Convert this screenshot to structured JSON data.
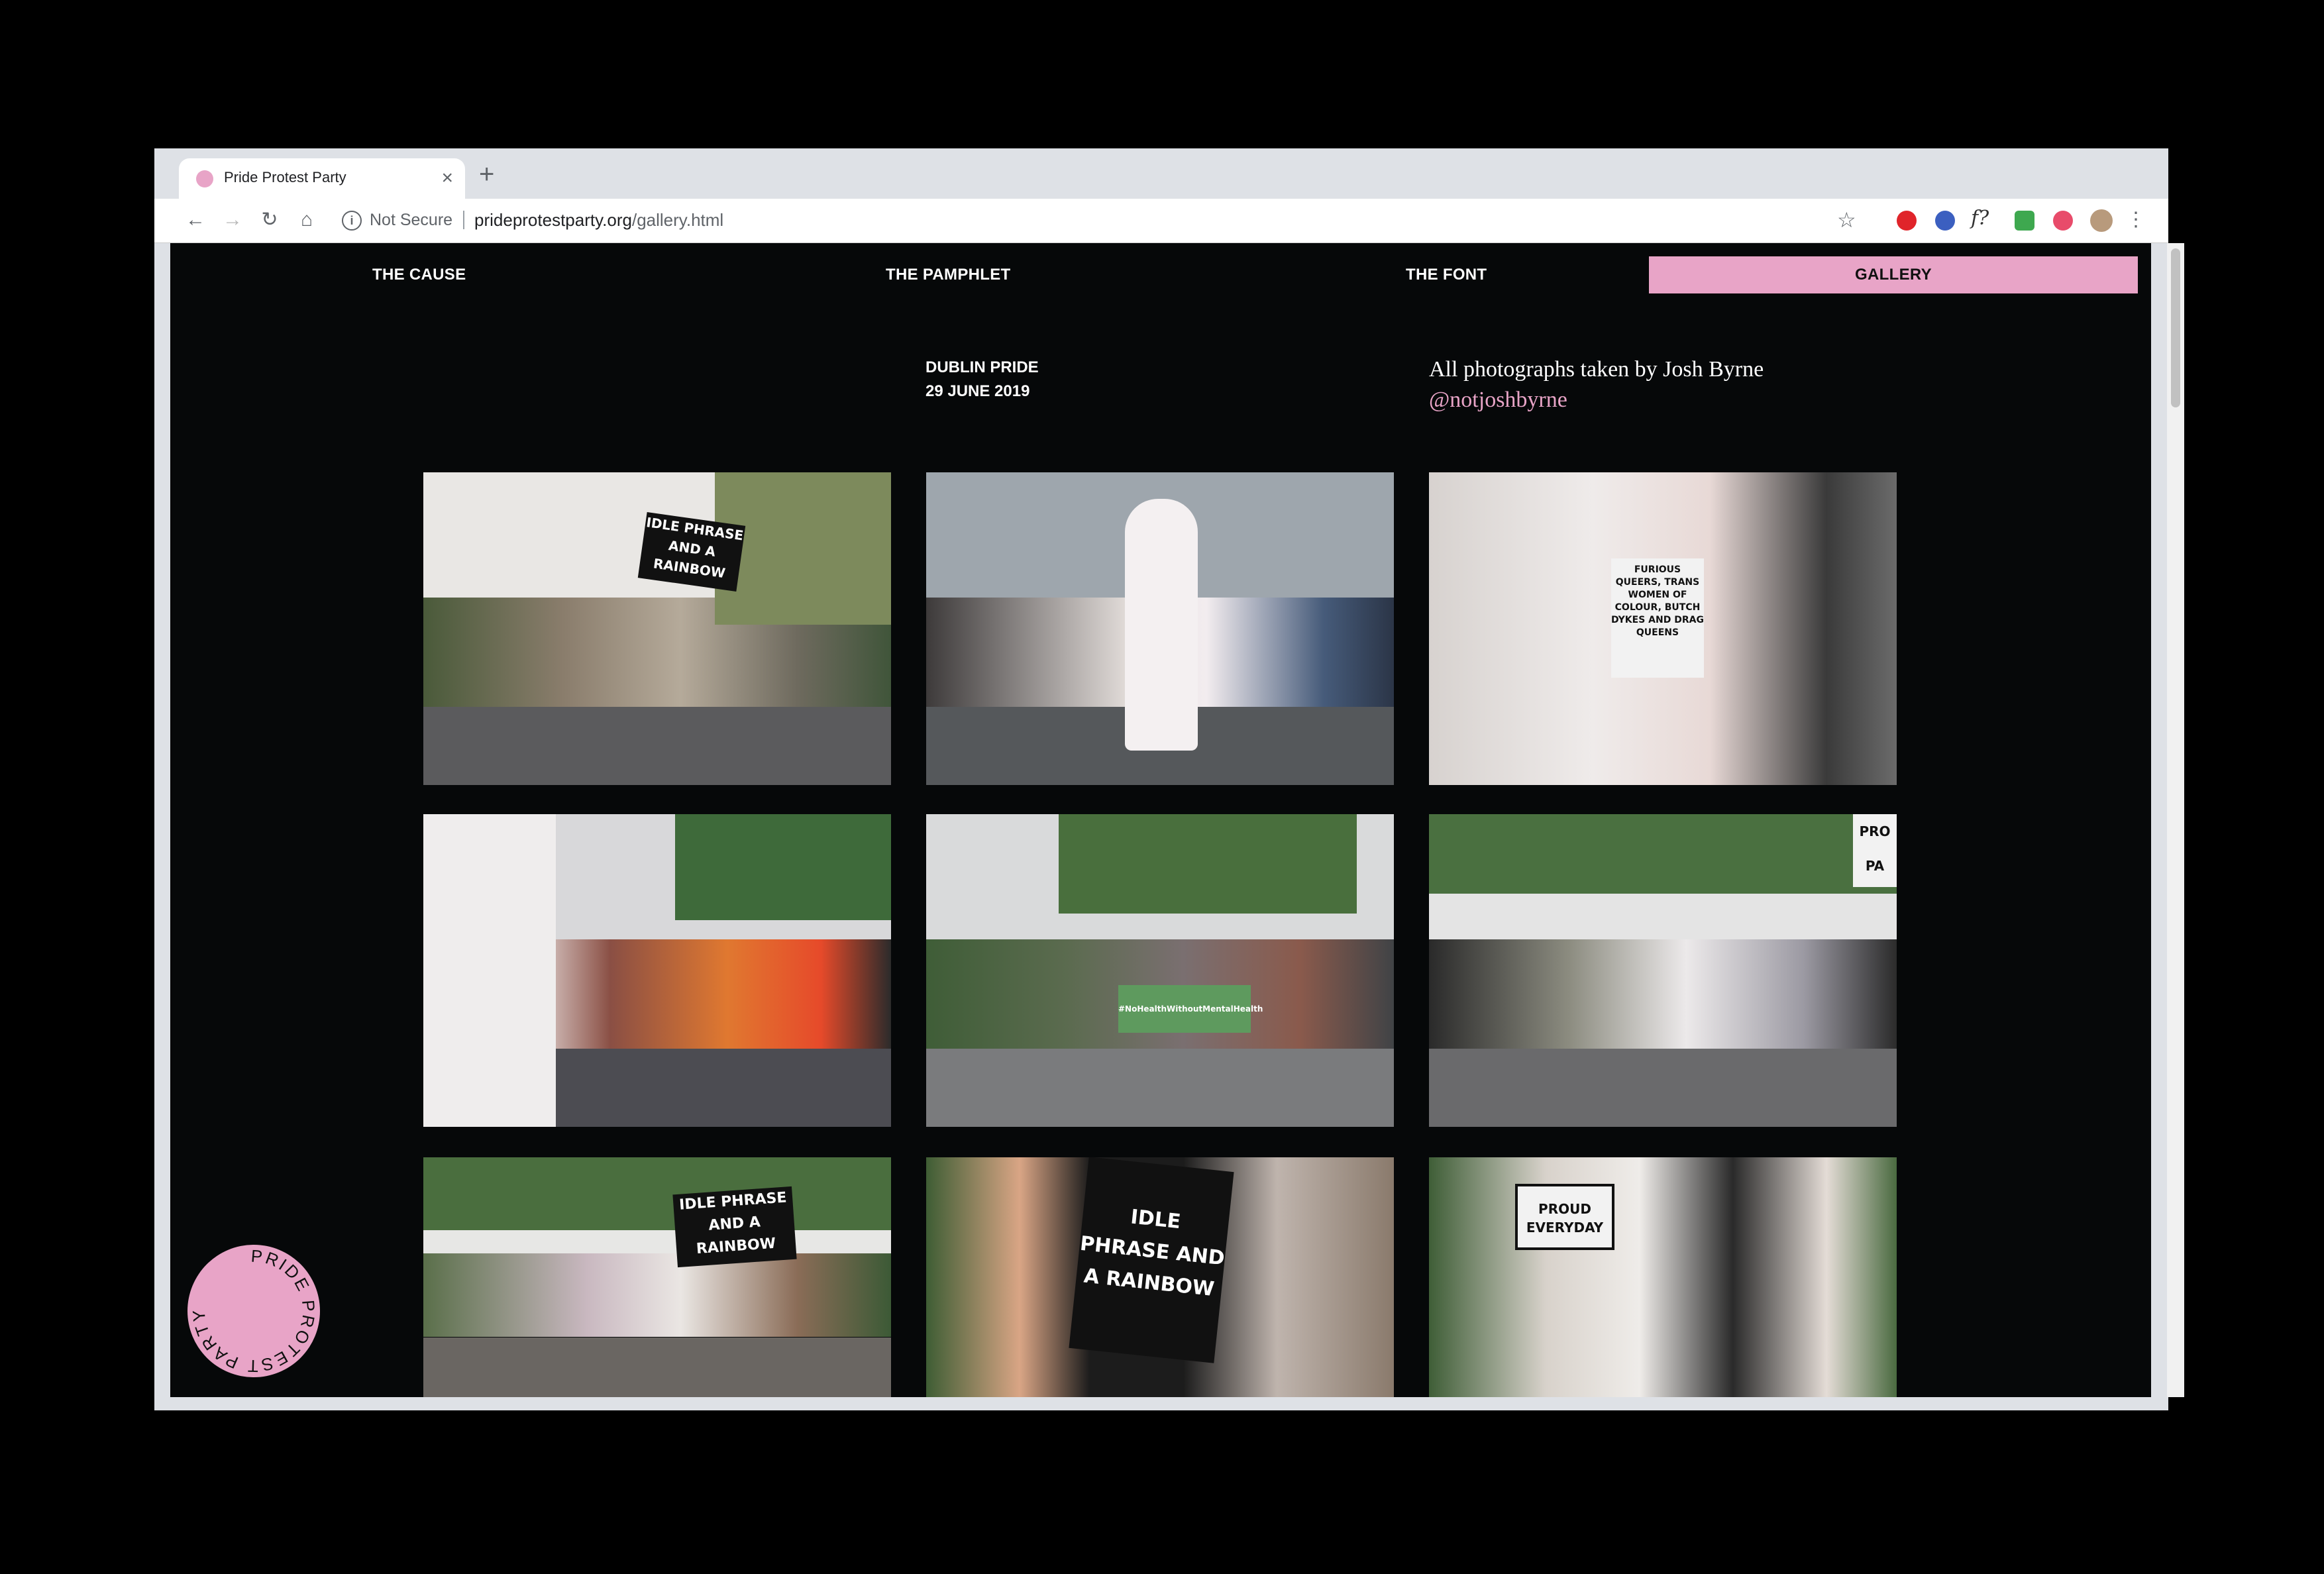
{
  "browser": {
    "tab_title": "Pride Protest Party",
    "new_tab": "+",
    "close": "×",
    "security": "Not Secure",
    "url_domain": "prideprotestparty.org",
    "url_path": "/gallery.html"
  },
  "nav": {
    "cause": "THE CAUSE",
    "pamphlet": "THE PAMPHLET",
    "font": "THE FONT",
    "gallery": "GALLERY"
  },
  "event": {
    "name": "DUBLIN PRIDE",
    "date": "29 JUNE 2019"
  },
  "credit": {
    "text": "All photographs taken by Josh Byrne",
    "handle": "@notjoshbyrne"
  },
  "photos": {
    "p1_banner": "IDLE PHRASE AND A RAINBOW",
    "p3_sign": "FURIOUS QUEERS, TRANS WOMEN OF COLOUR, BUTCH DYKES AND DRAG QUEENS",
    "p5_banner": "#NoHealthWithoutMentalHealth",
    "p6_sign": "PRO PA",
    "p7_banner": "IDLE PHRASE AND A RAINBOW",
    "p8_banner": "IDLE PHRASE AND A RAINBOW",
    "p9_sign": "PROUD EVERYDAY"
  },
  "logo_text": "PRIDE PROTEST PARTY",
  "colors": {
    "accent": "#e8a4c7",
    "page_bg": "#060809"
  }
}
